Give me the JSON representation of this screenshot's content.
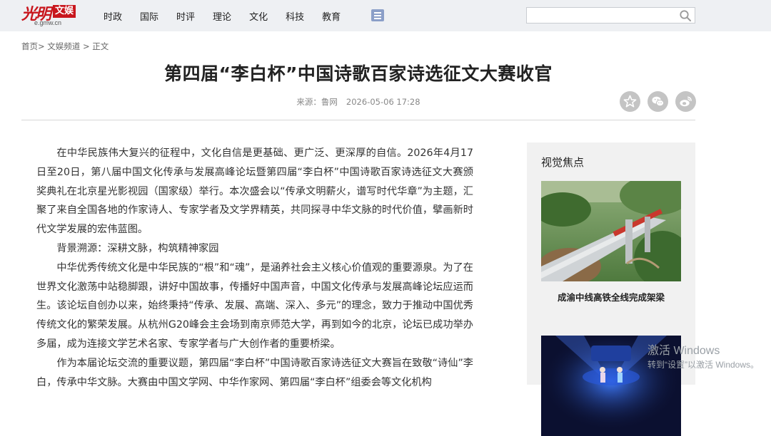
{
  "header": {
    "logo_script": "光明",
    "logo_box": "文娱",
    "logo_domain": "e.gmw.cn",
    "nav": [
      "时政",
      "国际",
      "时评",
      "理论",
      "文化",
      "科技",
      "教育"
    ],
    "search_placeholder": ""
  },
  "breadcrumb": {
    "home": "首页",
    "sep1": ">",
    "channel": "文娱频道",
    "sep2": ">",
    "current": "正文"
  },
  "article": {
    "title": "第四届“李白杯”中国诗歌百家诗选征文大赛收官",
    "source": "来源：鲁网",
    "datetime": "2026-05-06 17:28",
    "paragraphs": [
      "在中华民族伟大复兴的征程中，文化自信是更基础、更广泛、更深厚的自信。2026年4月17日至20日，第八届中国文化传承与发展高峰论坛暨第四届“李白杯”中国诗歌百家诗选征文大赛颁奖典礼在北京星光影视园（国家级）举行。本次盛会以“传承文明薪火，谱写时代华章”为主题，汇聚了来自全国各地的作家诗人、专家学者及文学界精英，共同探寻中华文脉的时代价值，擘画新时代文学发展的宏伟蓝图。",
      "背景溯源：深耕文脉，构筑精神家园",
      "中华优秀传统文化是中华民族的“根”和“魂”，是涵养社会主义核心价值观的重要源泉。为了在世界文化激荡中站稳脚跟，讲好中国故事，传播好中国声音，中国文化传承与发展高峰论坛应运而生。该论坛自创办以来，始终秉持“传承、发展、高端、深入、多元”的理念，致力于推动中国优秀传统文化的繁荣发展。从杭州G20峰会主会场到南京师范大学，再到如今的北京，论坛已成功举办多届，成为连接文学艺术名家、专家学者与广大创作者的重要桥梁。",
      "作为本届论坛交流的重要议题，第四届“李白杯”中国诗歌百家诗选征文大赛旨在致敬“诗仙”李白，传承中华文脉。大赛由中国文学网、中华作家网、第四届“李白杯”组委会等文化机构"
    ]
  },
  "sidebar": {
    "heading": "视觉焦点",
    "cards": [
      {
        "caption": "成渝中线高铁全线完成架梁"
      },
      {
        "caption": ""
      }
    ]
  },
  "watermark": {
    "line1": "激活 Windows",
    "line2": "转到“设置”以激活 Windows。"
  },
  "colors": {
    "topbar_bg": "#eef0f3",
    "brand_red": "#c8161d",
    "menu_icon": "#8b9fc8",
    "share_icon_bg": "#c4c4c4",
    "sidebar_bg": "#f1f1f1"
  },
  "icons": [
    "menu-icon",
    "search-icon",
    "favorite-star-icon",
    "wechat-icon",
    "weibo-icon"
  ]
}
